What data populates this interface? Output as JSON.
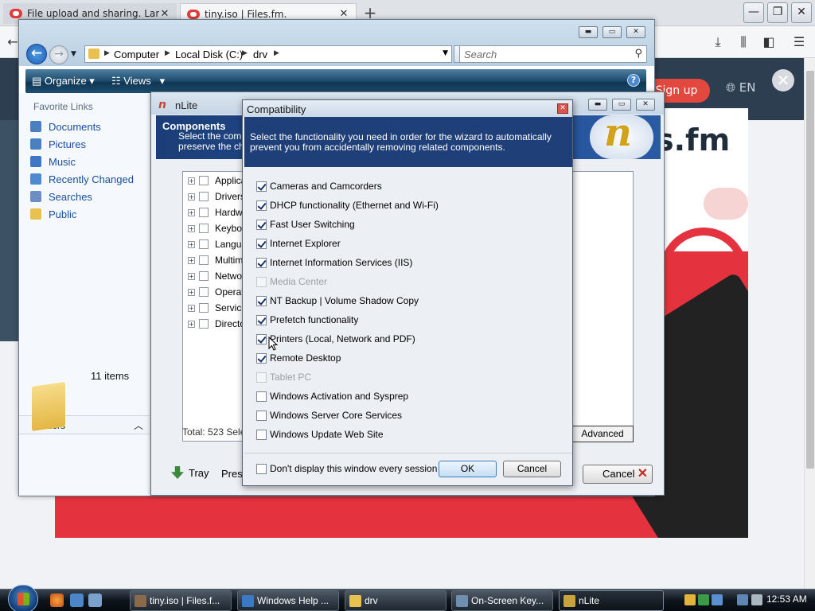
{
  "browser": {
    "tabs": [
      {
        "label": "File upload and sharing. Large",
        "active": false
      },
      {
        "label": "tiny.iso | Files.fm.",
        "active": true
      }
    ],
    "signup_label": "Sign up",
    "language": "EN",
    "promo_logo": "s.fm"
  },
  "explorer": {
    "breadcrumb": [
      "Computer",
      "Local Disk (C:)",
      "drv"
    ],
    "search_placeholder": "Search",
    "toolbar": {
      "organize": "Organize",
      "views": "Views"
    },
    "favorite_links_title": "Favorite Links",
    "favorites": [
      {
        "label": "Documents",
        "icon": "documents-icon",
        "color": "#4a7fc0"
      },
      {
        "label": "Pictures",
        "icon": "pictures-icon",
        "color": "#4a7fc0"
      },
      {
        "label": "Music",
        "icon": "music-icon",
        "color": "#3f77c4"
      },
      {
        "label": "Recently Changed",
        "icon": "recently-changed-icon",
        "color": "#4f8ad0"
      },
      {
        "label": "Searches",
        "icon": "searches-icon",
        "color": "#6b8fc4"
      },
      {
        "label": "Public",
        "icon": "public-folder-icon",
        "color": "#e7c24f"
      }
    ],
    "folders_label": "Folders",
    "items_count": "11 items"
  },
  "nlite": {
    "title": "nLite",
    "header_title": "Components",
    "header_desc_line1": "Select the comp",
    "header_desc_line2": "preserve the ch",
    "tree_items": [
      "Applica",
      "Drivers",
      "Hardw",
      "Keybo",
      "Langua",
      "Multime",
      "Netwo",
      "Operat",
      "Service",
      "Directo"
    ],
    "total_label": "Total: 523 Sele",
    "advanced_label": "Advanced",
    "tray_label": "Tray",
    "preset_label": "Prese",
    "cancel_label": "Cancel"
  },
  "compat": {
    "title": "Compatibility",
    "banner_text": "Select the functionality you need in order for the wizard to automatically prevent you from accidentally removing related components.",
    "options": [
      {
        "label": "Cameras and Camcorders",
        "checked": true,
        "disabled": false
      },
      {
        "label": "DHCP functionality (Ethernet and Wi-Fi)",
        "checked": true,
        "disabled": false
      },
      {
        "label": "Fast User Switching",
        "checked": true,
        "disabled": false
      },
      {
        "label": "Internet Explorer",
        "checked": true,
        "disabled": false
      },
      {
        "label": "Internet Information Services (IIS)",
        "checked": true,
        "disabled": false
      },
      {
        "label": "Media Center",
        "checked": false,
        "disabled": true
      },
      {
        "label": "NT Backup | Volume Shadow Copy",
        "checked": true,
        "disabled": false
      },
      {
        "label": "Prefetch functionality",
        "checked": true,
        "disabled": false
      },
      {
        "label": "Printers (Local, Network and PDF)",
        "checked": true,
        "disabled": false
      },
      {
        "label": "Remote Desktop",
        "checked": true,
        "disabled": false
      },
      {
        "label": "Tablet PC",
        "checked": false,
        "disabled": true
      },
      {
        "label": "Windows Activation and Sysprep",
        "checked": false,
        "disabled": false
      },
      {
        "label": "Windows Server Core Services",
        "checked": false,
        "disabled": false
      },
      {
        "label": "Windows Update Web Site",
        "checked": false,
        "disabled": false
      }
    ],
    "dont_display_label": "Don't display this window every session",
    "dont_display_checked": false,
    "ok_label": "OK",
    "cancel_label": "Cancel"
  },
  "taskbar": {
    "tasks": [
      {
        "label": "tiny.iso | Files.f...",
        "icon": "firefox-icon",
        "color": "#8a6a4a",
        "active": false
      },
      {
        "label": "Windows Help ...",
        "icon": "help-icon",
        "color": "#3c78c8",
        "active": false
      },
      {
        "label": "drv",
        "icon": "folder-icon",
        "color": "#e7c24f",
        "active": false
      },
      {
        "label": "On-Screen Key...",
        "icon": "keyboard-icon",
        "color": "#6f8fb0",
        "active": false
      },
      {
        "label": "nLite",
        "icon": "nlite-icon",
        "color": "#c8a23a",
        "active": true
      }
    ],
    "clock": "12:53 AM"
  }
}
